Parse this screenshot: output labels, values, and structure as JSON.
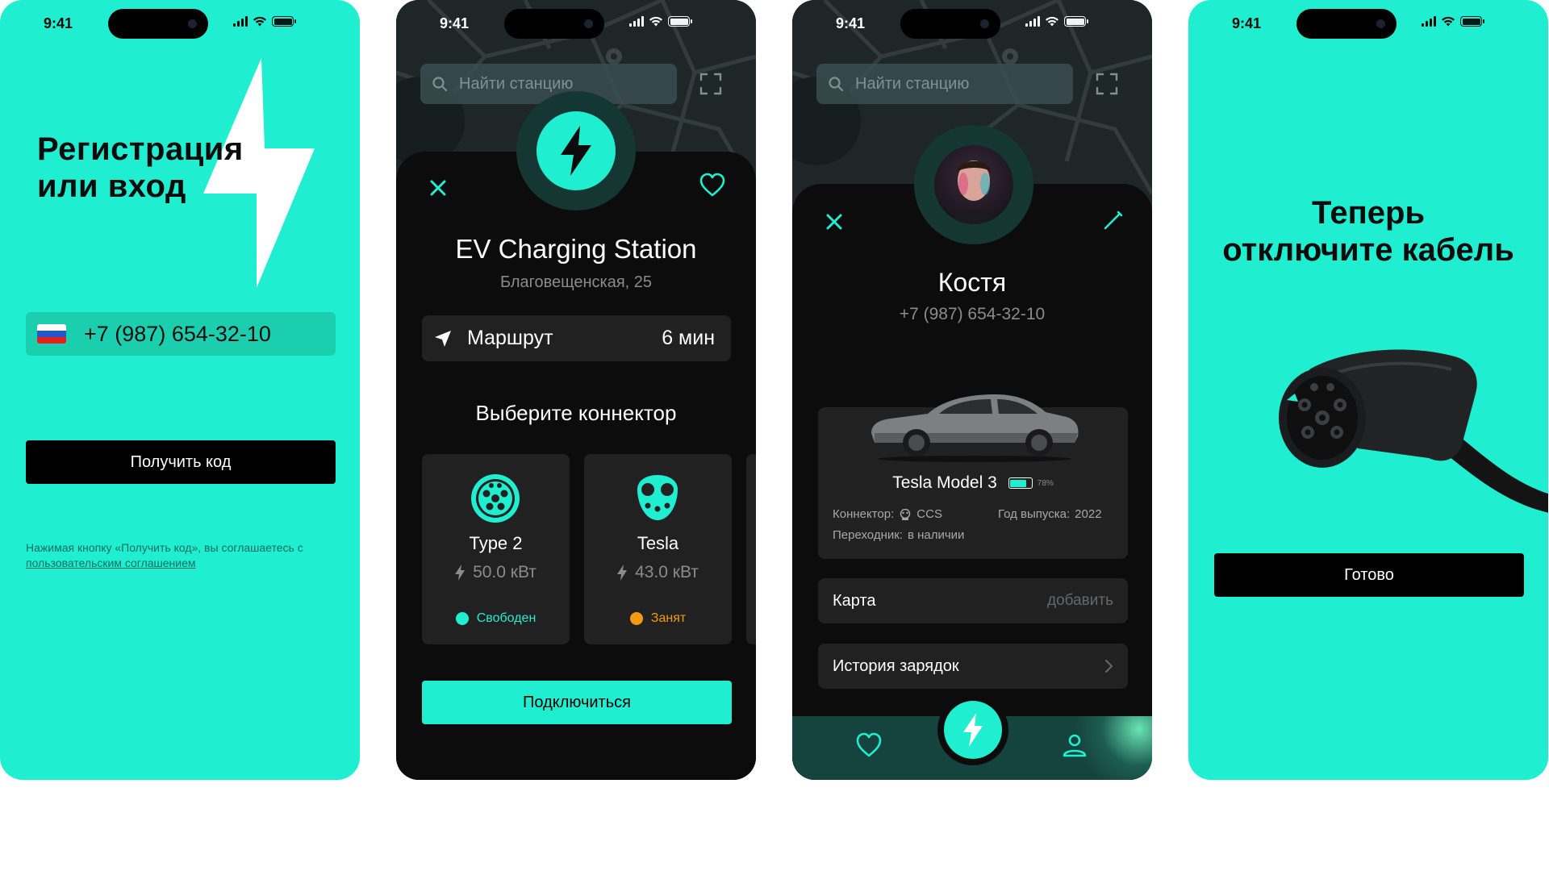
{
  "status": {
    "time": "9:41"
  },
  "screen1": {
    "title": "Регистрация\nили вход",
    "phone_number": "+7 (987) 654-32-10",
    "button": "Получить код",
    "legal_text": "Нажимая кнопку «Получить код», вы соглашаетесь с ",
    "legal_link": "пользовательским соглашением",
    "colors": {
      "accent": "#20eed0"
    }
  },
  "screen2": {
    "search_placeholder": "Найти станцию",
    "station_name": "EV Charging Station",
    "address": "Благовещенская, 25",
    "route_label": "Маршрут",
    "route_time": "6 мин",
    "connector_heading": "Выберите коннектор",
    "connectors": [
      {
        "name": "Type 2",
        "power": "50.0 кВт",
        "status": "Свободен",
        "status_color": "#20eed0"
      },
      {
        "name": "Tesla",
        "power": "43.0 кВт",
        "status": "Занят",
        "status_color": "#f59a12"
      }
    ],
    "button": "Подключиться"
  },
  "screen3": {
    "search_placeholder": "Найти станцию",
    "user_name": "Костя",
    "user_phone": "+7 (987) 654-32-10",
    "car": {
      "model": "Tesla Model 3",
      "battery_pct": "78%",
      "battery_level": 0.78,
      "connector_label": "Коннектор:",
      "connector_value": "CCS",
      "year_label": "Год выпуска:",
      "year_value": "2022",
      "adapter_label": "Переходник:",
      "adapter_value": "в наличии"
    },
    "card_label": "Карта",
    "card_action": "добавить",
    "history_label": "История зарядок",
    "tabs": [
      "heart-icon",
      "bolt-icon",
      "user-icon"
    ]
  },
  "screen4": {
    "title": "Теперь\nотключите кабель",
    "button": "Готово"
  }
}
